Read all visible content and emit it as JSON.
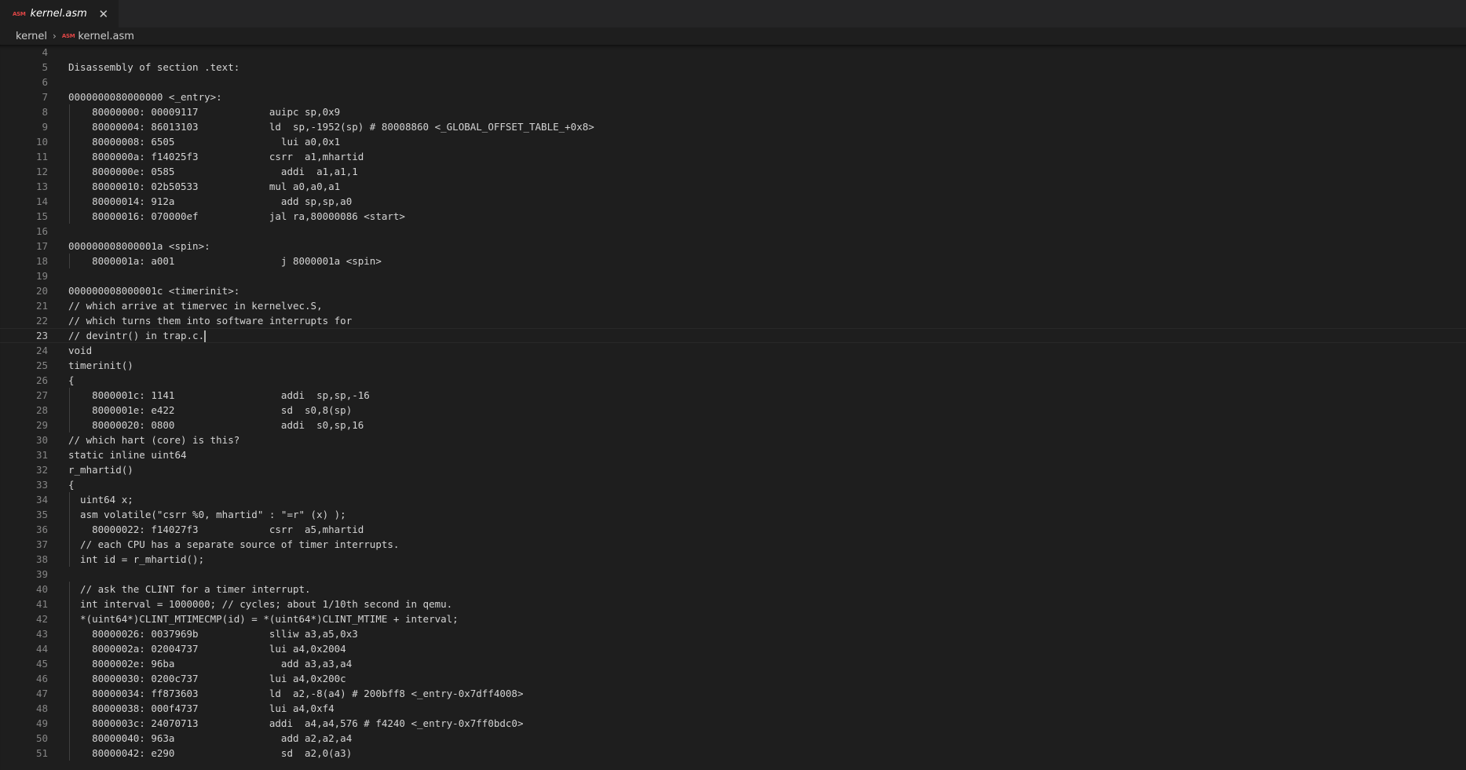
{
  "tab": {
    "icon": "ASM",
    "filename": "kernel.asm",
    "close_glyph": "✕"
  },
  "breadcrumb": {
    "folder": "kernel",
    "separator": "›",
    "icon": "ASM",
    "file": "kernel.asm"
  },
  "editor": {
    "cursor_line": 23,
    "lines": [
      {
        "n": "4",
        "text": ""
      },
      {
        "n": "5",
        "text": "Disassembly of section .text:"
      },
      {
        "n": "6",
        "text": ""
      },
      {
        "n": "7",
        "text": "0000000080000000 <_entry>:"
      },
      {
        "n": "8",
        "text": "    80000000: 00009117            auipc sp,0x9"
      },
      {
        "n": "9",
        "text": "    80000004: 86013103            ld  sp,-1952(sp) # 80008860 <_GLOBAL_OFFSET_TABLE_+0x8>"
      },
      {
        "n": "10",
        "text": "    80000008: 6505                  lui a0,0x1"
      },
      {
        "n": "11",
        "text": "    8000000a: f14025f3            csrr  a1,mhartid"
      },
      {
        "n": "12",
        "text": "    8000000e: 0585                  addi  a1,a1,1"
      },
      {
        "n": "13",
        "text": "    80000010: 02b50533            mul a0,a0,a1"
      },
      {
        "n": "14",
        "text": "    80000014: 912a                  add sp,sp,a0"
      },
      {
        "n": "15",
        "text": "    80000016: 070000ef            jal ra,80000086 <start>"
      },
      {
        "n": "16",
        "text": ""
      },
      {
        "n": "17",
        "text": "000000008000001a <spin>:"
      },
      {
        "n": "18",
        "text": "    8000001a: a001                  j 8000001a <spin>"
      },
      {
        "n": "19",
        "text": ""
      },
      {
        "n": "20",
        "text": "000000008000001c <timerinit>:"
      },
      {
        "n": "21",
        "text": "// which arrive at timervec in kernelvec.S,"
      },
      {
        "n": "22",
        "text": "// which turns them into software interrupts for"
      },
      {
        "n": "23",
        "text": "// devintr() in trap.c."
      },
      {
        "n": "24",
        "text": "void"
      },
      {
        "n": "25",
        "text": "timerinit()"
      },
      {
        "n": "26",
        "text": "{"
      },
      {
        "n": "27",
        "text": "    8000001c: 1141                  addi  sp,sp,-16"
      },
      {
        "n": "28",
        "text": "    8000001e: e422                  sd  s0,8(sp)"
      },
      {
        "n": "29",
        "text": "    80000020: 0800                  addi  s0,sp,16"
      },
      {
        "n": "30",
        "text": "// which hart (core) is this?"
      },
      {
        "n": "31",
        "text": "static inline uint64"
      },
      {
        "n": "32",
        "text": "r_mhartid()"
      },
      {
        "n": "33",
        "text": "{"
      },
      {
        "n": "34",
        "text": "  uint64 x;"
      },
      {
        "n": "35",
        "text": "  asm volatile(\"csrr %0, mhartid\" : \"=r\" (x) );"
      },
      {
        "n": "36",
        "text": "    80000022: f14027f3            csrr  a5,mhartid"
      },
      {
        "n": "37",
        "text": "  // each CPU has a separate source of timer interrupts."
      },
      {
        "n": "38",
        "text": "  int id = r_mhartid();"
      },
      {
        "n": "39",
        "text": ""
      },
      {
        "n": "40",
        "text": "  // ask the CLINT for a timer interrupt."
      },
      {
        "n": "41",
        "text": "  int interval = 1000000; // cycles; about 1/10th second in qemu."
      },
      {
        "n": "42",
        "text": "  *(uint64*)CLINT_MTIMECMP(id) = *(uint64*)CLINT_MTIME + interval;"
      },
      {
        "n": "43",
        "text": "    80000026: 0037969b            slliw a3,a5,0x3"
      },
      {
        "n": "44",
        "text": "    8000002a: 02004737            lui a4,0x2004"
      },
      {
        "n": "45",
        "text": "    8000002e: 96ba                  add a3,a3,a4"
      },
      {
        "n": "46",
        "text": "    80000030: 0200c737            lui a4,0x200c"
      },
      {
        "n": "47",
        "text": "    80000034: ff873603            ld  a2,-8(a4) # 200bff8 <_entry-0x7dff4008>"
      },
      {
        "n": "48",
        "text": "    80000038: 000f4737            lui a4,0xf4"
      },
      {
        "n": "49",
        "text": "    8000003c: 24070713            addi  a4,a4,576 # f4240 <_entry-0x7ff0bdc0>"
      },
      {
        "n": "50",
        "text": "    80000040: 963a                  add a2,a2,a4"
      },
      {
        "n": "51",
        "text": "    80000042: e290                  sd  a2,0(a3)"
      }
    ]
  }
}
